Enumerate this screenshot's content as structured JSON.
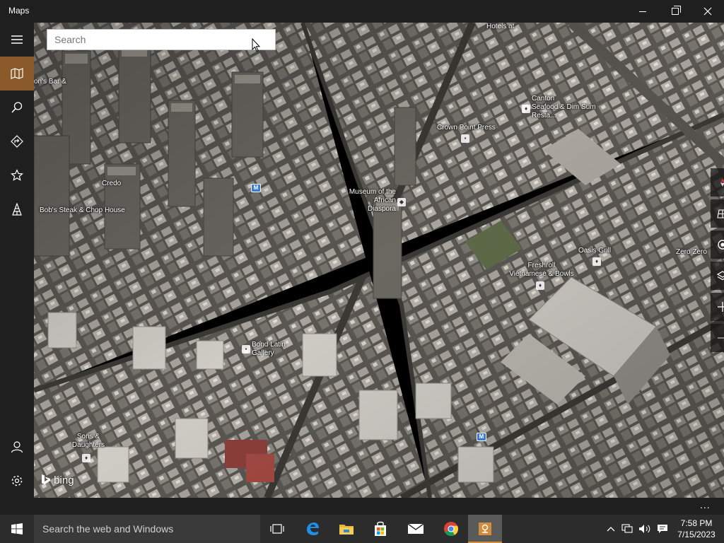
{
  "window": {
    "title": "Maps",
    "controls": {
      "minimize": "minimize",
      "maximize": "maximize",
      "close": "close"
    }
  },
  "nav": {
    "items": [
      {
        "icon": "hamburger-icon",
        "active": false
      },
      {
        "icon": "map-icon",
        "active": true
      },
      {
        "icon": "search-icon",
        "active": false
      },
      {
        "icon": "directions-icon",
        "active": false
      },
      {
        "icon": "favorites-icon",
        "active": false
      },
      {
        "icon": "city-tours-icon",
        "active": false
      }
    ],
    "bottom": [
      {
        "icon": "account-icon"
      },
      {
        "icon": "settings-icon"
      }
    ]
  },
  "search": {
    "placeholder": "Search"
  },
  "map": {
    "mode": "3D aerial",
    "labels": {
      "tonys_bar": "on's Bar &",
      "credo": "Credo",
      "bobs_steak": "Bob's Steak & Chop House",
      "museum": "Museum of the\nAfrican\nDiaspora",
      "crown_point": "Crown Point Press",
      "canton": "Canton\nSeafood & Dim Sum\nResta...",
      "oasis": "Oasis Grill",
      "zero_zero": "Zero Zero",
      "freshroll": "Freshroll\nVietnamese & Bowls",
      "bond_latin": "Bond Latin\nGallery",
      "sons_daughters": "Sons &\nDaughters",
      "top_label": "Hotels at"
    },
    "metro_symbol": "M",
    "attribution": "bing"
  },
  "map_controls": [
    {
      "icon": "compass-icon"
    },
    {
      "icon": "tilt-3d-icon"
    },
    {
      "icon": "locate-me-icon"
    },
    {
      "icon": "map-layers-icon"
    },
    {
      "icon": "zoom-in-icon"
    },
    {
      "icon": "zoom-out-icon"
    }
  ],
  "commandbar": {
    "more": "..."
  },
  "taskbar": {
    "search_placeholder": "Search the web and Windows",
    "apps": [
      {
        "icon": "task-view-icon"
      },
      {
        "icon": "edge-icon"
      },
      {
        "icon": "file-explorer-icon"
      },
      {
        "icon": "store-icon"
      },
      {
        "icon": "mail-icon"
      },
      {
        "icon": "chrome-icon"
      },
      {
        "icon": "maps-app-icon",
        "active": true
      }
    ],
    "tray": [
      "show-hidden-icons-icon",
      "network-icon",
      "volume-icon",
      "action-center-icon"
    ],
    "time": "7:58 PM",
    "date": "7/15/2023"
  },
  "colors": {
    "accent": "#8a5a2b",
    "chrome": "#1f1f1f",
    "taskbar": "#2c2c2c"
  }
}
